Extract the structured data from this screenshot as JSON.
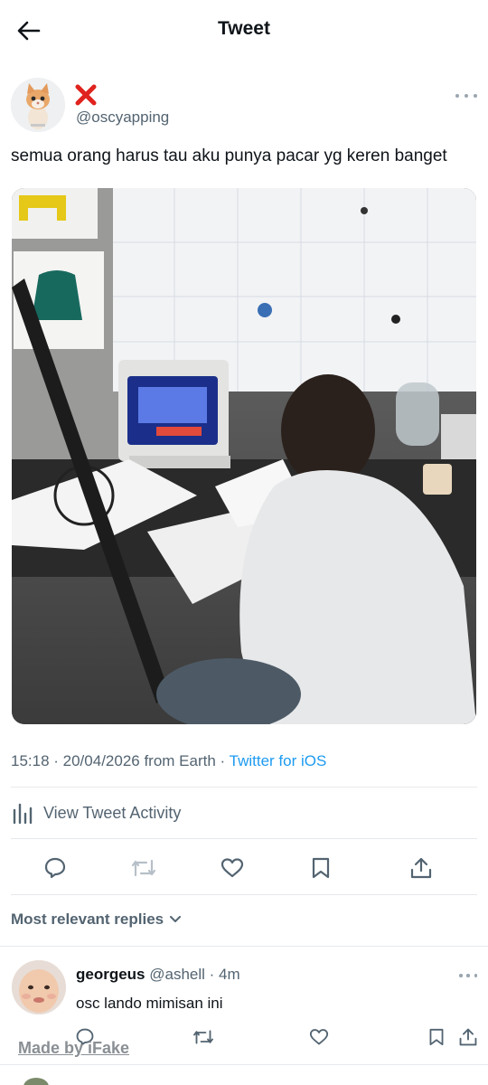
{
  "header": {
    "title": "Tweet",
    "back_icon": "arrow-left-icon"
  },
  "tweet": {
    "author_handle": "@oscyapping",
    "author_name_icon": "red-x-mark-icon",
    "text": "semua orang harus tau aku punya pacar yg keren banget",
    "media_description_icon": "photo",
    "timestamp": "15:18 · 20/04/2026 from Earth · ",
    "client": "Twitter for iOS",
    "activity_label": "View Tweet Activity"
  },
  "actions": [
    "reply-icon",
    "retweet-icon",
    "like-icon",
    "bookmark-icon",
    "share-icon"
  ],
  "replies": {
    "heading": "Most relevant replies",
    "items": [
      {
        "name": "georgeus",
        "handle": "@ashell",
        "time": " · 4m",
        "text": "osc lando mimisan ini"
      }
    ]
  },
  "watermark": "Made by iFake",
  "colors": {
    "accent": "#1d9bf0",
    "secondary_text": "#536471",
    "primary_text": "#0f1419",
    "divider": "#e6e9ec",
    "red_mark": "#e0231e"
  }
}
